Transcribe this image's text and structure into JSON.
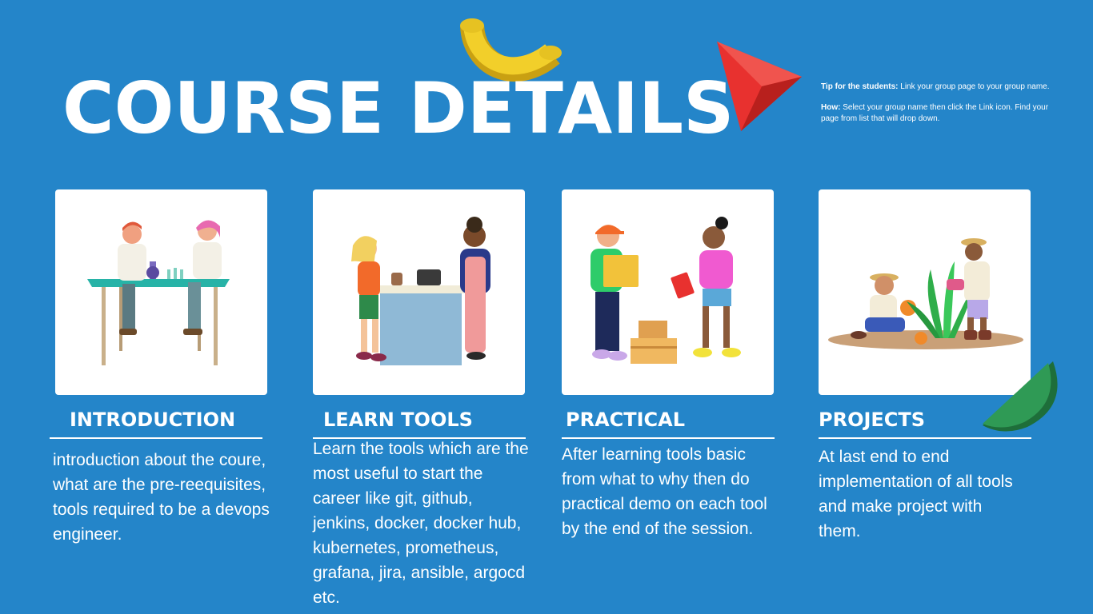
{
  "page": {
    "title": "COURSE DETAILS"
  },
  "tip": {
    "label1": "Tip for the students:",
    "text1": " Link your group page to your group name.",
    "label2": "How:",
    "text2": " Select your group name then click the Link icon. Find your page from list that will drop down."
  },
  "sections": [
    {
      "heading": "INTRODUCTION",
      "description": "introduction about the coure, what are the pre-reequisites, tools required to be a devops engineer.",
      "illustration": "scientists-at-table"
    },
    {
      "heading": "LEARN TOOLS",
      "description": "Learn the tools which are the most useful to start the career like git, github, jenkins, docker, docker hub, kubernetes, prometheus, grafana, jira, ansible, argocd etc.",
      "illustration": "shop-counter"
    },
    {
      "heading": "PRACTICAL",
      "description": "After learning tools basic from what to why then do practical demo on each tool by the end of the session.",
      "illustration": "delivery-boxes"
    },
    {
      "heading": "PROJECTS",
      "description": "At last end to end implementation of all tools and make project with  them.",
      "illustration": "gardeners-planting"
    }
  ],
  "colors": {
    "background": "#2485c9",
    "text": "#ffffff",
    "yellow": "#f2cf2a",
    "red": "#e8312f",
    "green": "#2f9a55"
  }
}
